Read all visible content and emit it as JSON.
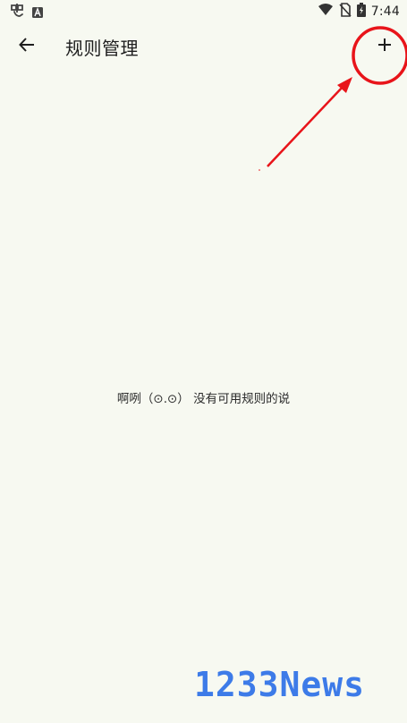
{
  "status_bar": {
    "time": "7:44",
    "icons": [
      "app-notification-icon",
      "a-badge-icon",
      "wifi-icon",
      "no-sim-icon",
      "battery-charging-icon"
    ]
  },
  "header": {
    "title": "规则管理",
    "back_icon": "arrow-left-icon",
    "add_icon": "plus-icon"
  },
  "empty_state": {
    "message": "啊咧（⊙.⊙） 没有可用规则的说"
  },
  "annotation": {
    "color": "#e8141a"
  },
  "watermark": {
    "text": "1233News",
    "color": "#3d7be8"
  },
  "colors": {
    "background": "#f7f9f1",
    "text": "#1e1e1e"
  }
}
